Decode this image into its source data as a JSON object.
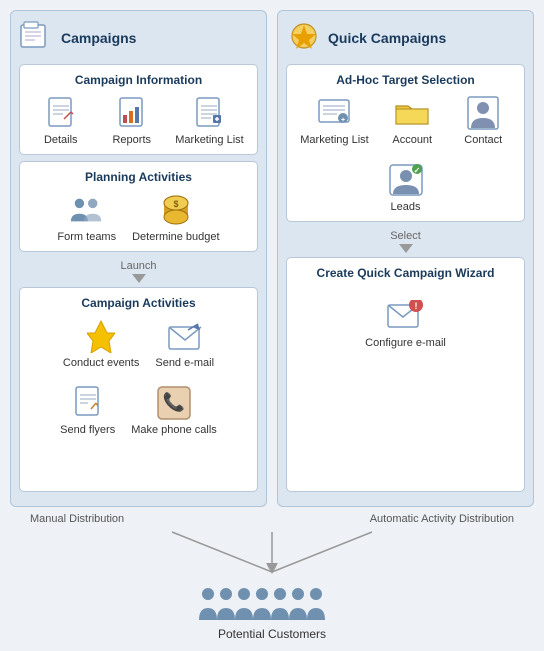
{
  "left_panel": {
    "title": "Campaigns",
    "icon": "🗂",
    "sections": {
      "campaign_info": {
        "title": "Campaign Information",
        "items": [
          {
            "label": "Details",
            "icon": "doc"
          },
          {
            "label": "Reports",
            "icon": "report"
          },
          {
            "label": "Marketing List",
            "icon": "list"
          }
        ]
      },
      "planning": {
        "title": "Planning Activities",
        "items": [
          {
            "label": "Form teams",
            "icon": "teams"
          },
          {
            "label": "Determine budget",
            "icon": "budget"
          }
        ]
      },
      "launch_label": "Launch",
      "campaign_activities": {
        "title": "Campaign Activities",
        "items": [
          {
            "label": "Conduct events",
            "icon": "lightning"
          },
          {
            "label": "Send e-mail",
            "icon": "email"
          },
          {
            "label": "Send flyers",
            "icon": "flyer"
          },
          {
            "label": "Make phone calls",
            "icon": "phone"
          }
        ]
      }
    }
  },
  "right_panel": {
    "title": "Quick Campaigns",
    "icon": "⚡",
    "sections": {
      "adhoc": {
        "title": "Ad-Hoc Target Selection",
        "items": [
          {
            "label": "Marketing List",
            "icon": "mktlist"
          },
          {
            "label": "Account",
            "icon": "account"
          },
          {
            "label": "Contact",
            "icon": "contact"
          },
          {
            "label": "Leads",
            "icon": "leads"
          }
        ]
      },
      "select_label": "Select",
      "wizard": {
        "title": "Create Quick Campaign Wizard",
        "items": [
          {
            "label": "Configure e-mail",
            "icon": "configure"
          }
        ]
      }
    }
  },
  "bottom": {
    "manual_label": "Manual Distribution",
    "auto_label": "Automatic Activity Distribution",
    "customers_label": "Potential Customers"
  }
}
